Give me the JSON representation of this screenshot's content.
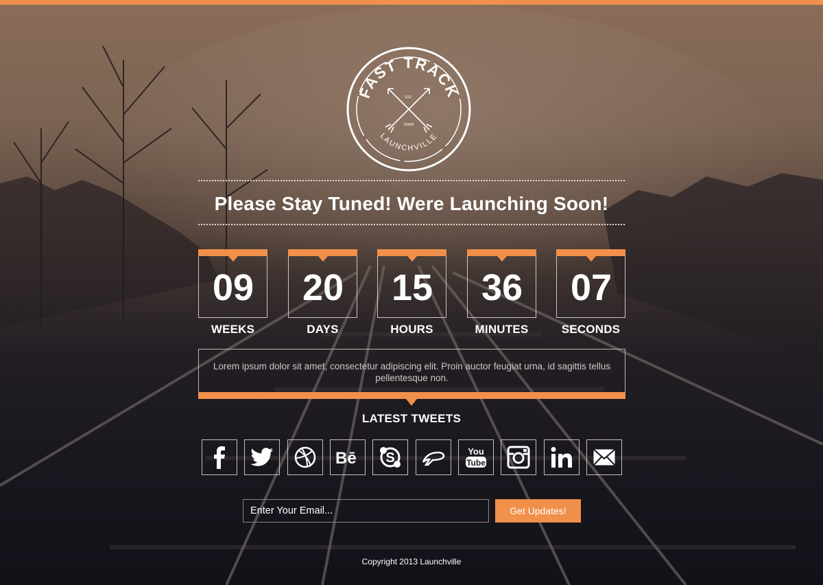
{
  "brand": {
    "name": "FAST TRACK",
    "location": "LAUNCHVILLE",
    "est": "EST.",
    "year": "XXMIII"
  },
  "headline": "Please Stay Tuned! Were Launching Soon!",
  "countdown": [
    {
      "value": "09",
      "label": "WEEKS"
    },
    {
      "value": "20",
      "label": "DAYS"
    },
    {
      "value": "15",
      "label": "HOURS"
    },
    {
      "value": "36",
      "label": "MINUTES"
    },
    {
      "value": "07",
      "label": "SECONDS"
    }
  ],
  "tweet": {
    "text": "Lorem ipsum dolor sit amet, consectetur adipiscing elit. Proin auctor feugiat urna, id sagittis tellus pellentesque non.",
    "title": "LATEST TWEETS"
  },
  "social": [
    "facebook-icon",
    "twitter-icon",
    "dribbble-icon",
    "behance-icon",
    "skype-icon",
    "deviantart-icon",
    "youtube-icon",
    "instagram-icon",
    "linkedin-icon",
    "email-icon"
  ],
  "subscribe": {
    "placeholder": "Enter Your Email...",
    "button": "Get Updates!"
  },
  "footer": {
    "copyright": "Copyright 2013 Launchville"
  },
  "colors": {
    "accent": "#f0904a"
  }
}
